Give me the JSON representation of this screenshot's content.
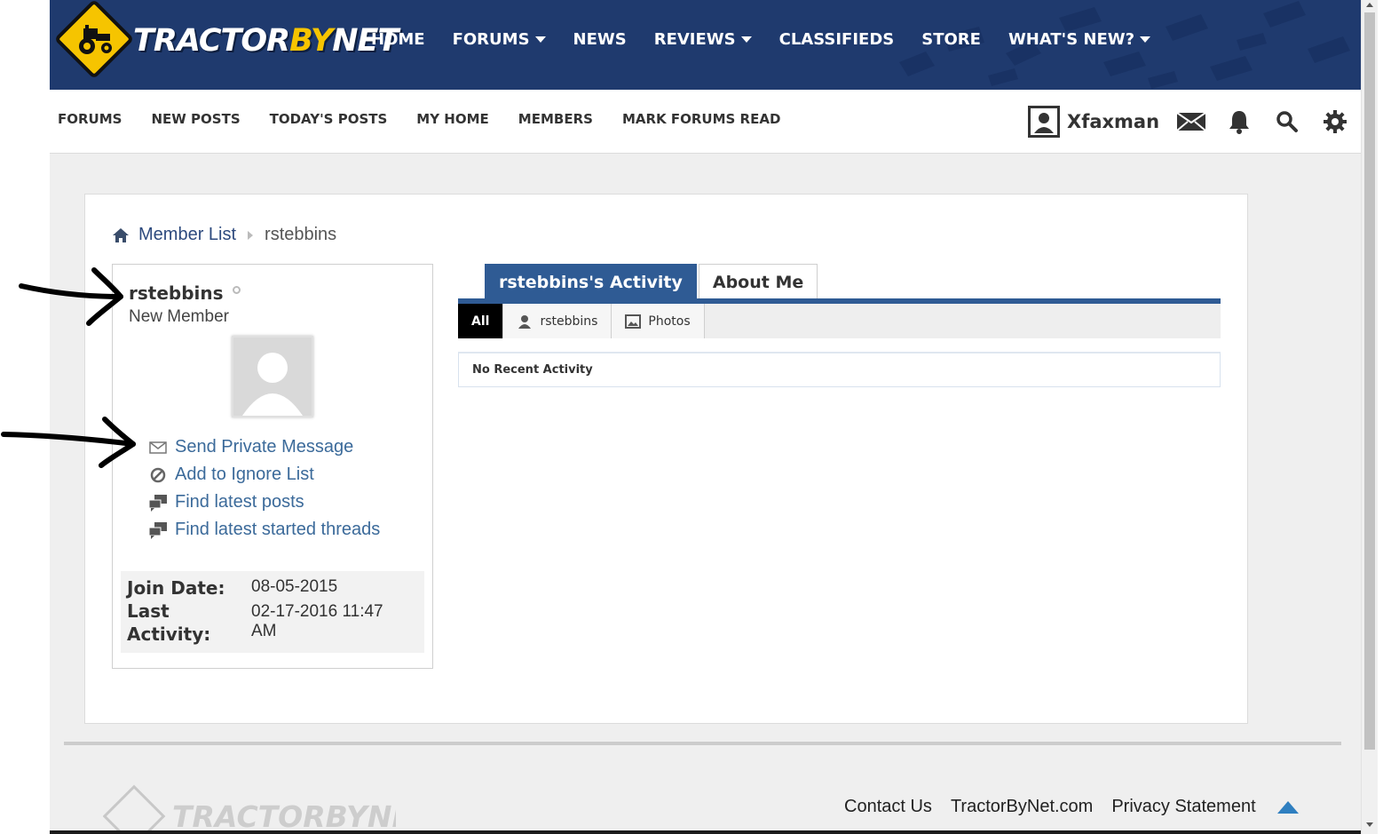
{
  "header": {
    "logo": {
      "part1": "TRACTOR",
      "part2": "BY",
      "part3": "NET"
    },
    "nav": [
      {
        "label": "HOME",
        "dropdown": false
      },
      {
        "label": "FORUMS",
        "dropdown": true
      },
      {
        "label": "NEWS",
        "dropdown": false
      },
      {
        "label": "REVIEWS",
        "dropdown": true
      },
      {
        "label": "CLASSIFIEDS",
        "dropdown": false
      },
      {
        "label": "STORE",
        "dropdown": false
      },
      {
        "label": "WHAT'S NEW?",
        "dropdown": true
      }
    ]
  },
  "subnav": {
    "items": [
      "FORUMS",
      "NEW POSTS",
      "TODAY'S POSTS",
      "MY HOME",
      "MEMBERS",
      "MARK FORUMS READ"
    ],
    "user": {
      "name": "Xfaxman",
      "icons": [
        "user-icon",
        "mail-icon",
        "bell-icon",
        "search-icon",
        "gear-icon"
      ]
    }
  },
  "breadcrumb": {
    "link": "Member List",
    "current": "rstebbins"
  },
  "profile": {
    "username": "rstebbins",
    "rank": "New Member",
    "actions": [
      {
        "label": "Send Private Message",
        "icon": "envelope-icon"
      },
      {
        "label": "Add to Ignore List",
        "icon": "ignore-icon"
      },
      {
        "label": "Find latest posts",
        "icon": "posts-icon"
      },
      {
        "label": "Find latest started threads",
        "icon": "threads-icon"
      }
    ],
    "stats": {
      "join_label": "Join Date:",
      "join_value": "08-05-2015",
      "last_label_1": "Last",
      "last_label_2": "Activity:",
      "last_value_1": "02-17-2016 11:47",
      "last_value_2": "AM"
    }
  },
  "activity": {
    "tabs": [
      {
        "label": "rstebbins's Activity",
        "active": true
      },
      {
        "label": "About Me",
        "active": false
      }
    ],
    "filters": [
      {
        "label": "All",
        "active": true
      },
      {
        "label": "rstebbins",
        "icon": "person-icon"
      },
      {
        "label": "Photos",
        "icon": "photo-icon"
      }
    ],
    "empty_message": "No Recent Activity"
  },
  "footer": {
    "links": [
      "Contact Us",
      "TractorByNet.com",
      "Privacy Statement"
    ],
    "logo": "TRACTORBYNET"
  },
  "colors": {
    "header_bg": "#1f3a6e",
    "accent_blue": "#2f5b94",
    "logo_yellow": "#f6c400",
    "link_blue": "#3b6a9a",
    "annotation": "#000000"
  }
}
